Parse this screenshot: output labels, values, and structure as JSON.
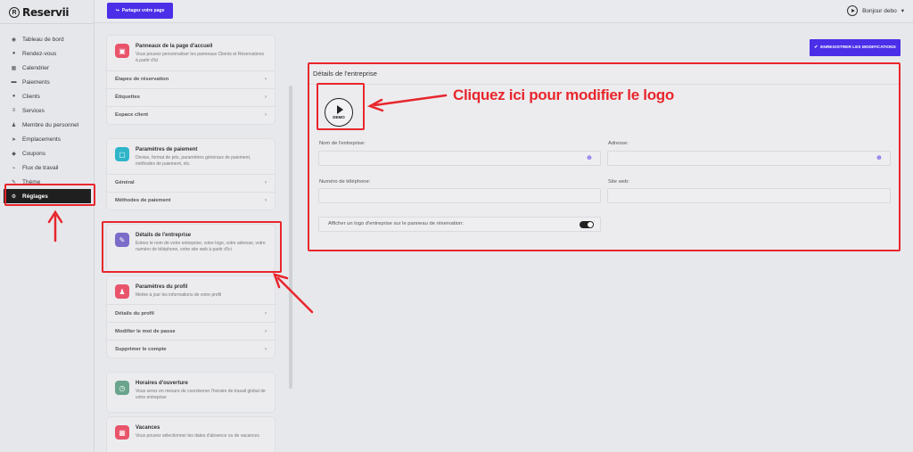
{
  "app": {
    "name": "Reservii",
    "logo_letter": "R"
  },
  "topbar": {
    "share_label": "Partagez votre page",
    "greeting": "Bonjour debo"
  },
  "sidebar": {
    "items": [
      {
        "label": "Tableau de bord",
        "icon": "dashboard-icon",
        "glyph": "◉"
      },
      {
        "label": "Rendez-vous",
        "icon": "calendar-check-icon",
        "glyph": "●"
      },
      {
        "label": "Calendrier",
        "icon": "calendar-icon",
        "glyph": "▦"
      },
      {
        "label": "Paiements",
        "icon": "credit-card-icon",
        "glyph": "▬"
      },
      {
        "label": "Clients",
        "icon": "users-icon",
        "glyph": "●"
      },
      {
        "label": "Services",
        "icon": "list-icon",
        "glyph": "≡"
      },
      {
        "label": "Membre du personnel",
        "icon": "staff-icon",
        "glyph": "♟"
      },
      {
        "label": "Emplacements",
        "icon": "location-arrow-icon",
        "glyph": "➤"
      },
      {
        "label": "Coupons",
        "icon": "tag-icon",
        "glyph": "◆"
      },
      {
        "label": "Flux de travail",
        "icon": "workflow-icon",
        "glyph": "⌁"
      },
      {
        "label": "Thème",
        "icon": "brush-icon",
        "glyph": "✎"
      },
      {
        "label": "Réglages",
        "icon": "gear-icon",
        "glyph": "⚙"
      }
    ],
    "active_index": 11
  },
  "settings_panel": {
    "card1": {
      "title": "Panneaux de la page d'accueil",
      "desc": "Vous pouvez personnaliser les panneaux Clients et Réservations à partir d'ici",
      "icon_color": "#e9546b",
      "rows": [
        "Étapes de réservation",
        "Étiquettes",
        "Espace client"
      ]
    },
    "card2": {
      "title": "Paramètres de paiement",
      "desc": "Devise, format de prix, paramètres généraux de paiement, méthodes de paiement, etc.",
      "icon_color": "#2fb5c8",
      "rows": [
        "Général",
        "Méthodes de paiement"
      ]
    },
    "card3": {
      "title": "Détails de l'entreprise",
      "desc": "Entrez le nom de votre entreprise, votre logo, votre adresse, votre numéro de téléphone, votre site web à partir d'ici",
      "icon_color": "#7b6cc9"
    },
    "card4": {
      "title": "Paramètres du profil",
      "desc": "Mettre à jour les informations de votre profil",
      "icon_color": "#e9546b",
      "rows": [
        "Détails du profil",
        "Modifier le mot de passe",
        "Supprimer le compte"
      ]
    },
    "card5": {
      "title": "Horaires d'ouverture",
      "desc": "Vous serez en mesure de coordonner l'horaire de travail global de votre entreprise",
      "icon_color": "#6aa48c"
    },
    "card6": {
      "title": "Vacances",
      "desc": "Vous pouvez sélectionner les dates d'absence ou de vacances",
      "icon_color": "#e9546b"
    }
  },
  "main": {
    "save_label": "ENREGISTRER LES MODIFICATIONS",
    "details_title": "Détails de l'entreprise",
    "logo_badge": "DEMO",
    "fields": {
      "company_name": {
        "label": "Nom de l'entreprise:",
        "value": ""
      },
      "address": {
        "label": "Adresse:",
        "value": ""
      },
      "phone": {
        "label": "Numéro de téléphone:",
        "value": ""
      },
      "website": {
        "label": "Site web:",
        "value": ""
      }
    },
    "toggle": {
      "label": "Afficher un logo d'entreprise sur le panneau de réservation:",
      "on": true
    }
  },
  "annotation": {
    "text": "Cliquez ici pour modifier le logo",
    "color": "#e8262c"
  }
}
